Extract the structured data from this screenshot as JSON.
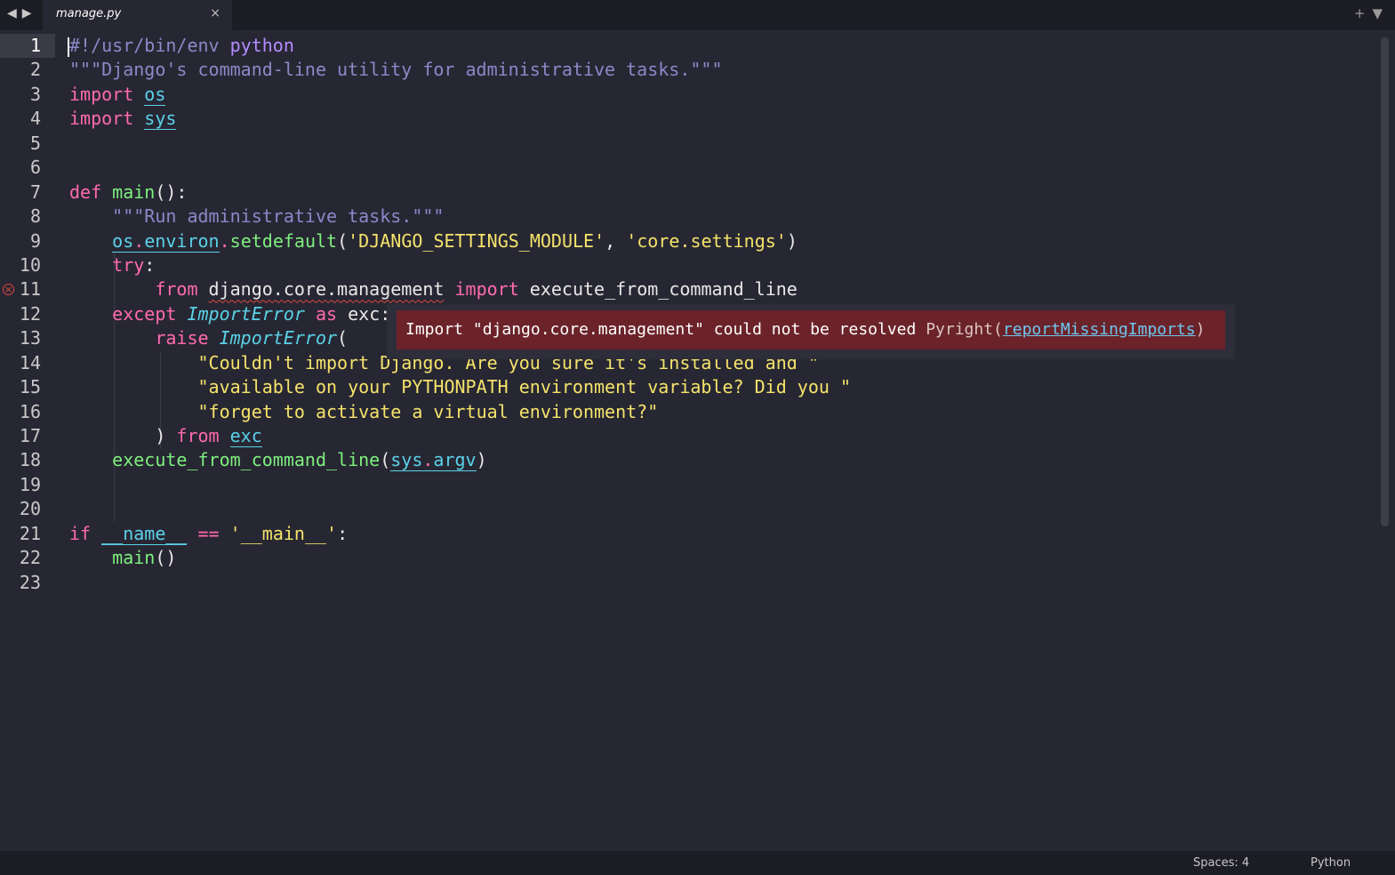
{
  "tabbar": {
    "back_label": "◀",
    "forward_label": "▶",
    "tab_title": "manage.py",
    "close_label": "×",
    "new_tab_label": "+",
    "menu_label": "▼"
  },
  "editor": {
    "line_numbers": [
      "1",
      "2",
      "3",
      "4",
      "5",
      "6",
      "7",
      "8",
      "9",
      "10",
      "11",
      "12",
      "13",
      "14",
      "15",
      "16",
      "17",
      "18",
      "19",
      "20",
      "21",
      "22",
      "23"
    ],
    "error_icon": "×",
    "code": {
      "l1_a": "#!/usr/bin/env ",
      "l1_b": "python",
      "l2": "\"\"\"Django's command-line utility for administrative tasks.\"\"\"",
      "l3_kw": "import",
      "l3_mod": "os",
      "l4_kw": "import",
      "l4_mod": "sys",
      "l7_kw": "def",
      "l7_fn": "main",
      "l7_rest": "():",
      "l8": "\"\"\"Run administrative tasks.\"\"\"",
      "l9_mod1": "os",
      "l9_dot1": ".",
      "l9_mod2": "environ",
      "l9_dot2": ".",
      "l9_fn": "setdefault",
      "l9_p1": "(",
      "l9_s1": "'DJANGO_SETTINGS_MODULE'",
      "l9_c": ", ",
      "l9_s2": "'core.settings'",
      "l9_p2": ")",
      "l10_kw": "try",
      "l10_rest": ":",
      "l11_kw1": "from",
      "l11_mod": "django.core.management",
      "l11_kw2": "import",
      "l11_rest": "execute_from_command_line",
      "l12_kw": "except",
      "l12_cls": "ImportError",
      "l12_kw2": "as",
      "l12_rest": "exc:",
      "l13_kw": "raise",
      "l13_cls": "ImportError",
      "l13_rest": "(",
      "l14": "\"Couldn't import Django. Are you sure it's installed and \"",
      "l15": "\"available on your PYTHONPATH environment variable? Did you \"",
      "l16": "\"forget to activate a virtual environment?\"",
      "l17_a": ") ",
      "l17_kw": "from",
      "l17_mod": "exc",
      "l18_fn": "execute_from_command_line",
      "l18_p1": "(",
      "l18_mod1": "sys",
      "l18_dot": ".",
      "l18_mod2": "argv",
      "l18_p2": ")",
      "l21_kw": "if",
      "l21_mod": "__name__",
      "l21_op": "==",
      "l21_str": "'__main__'",
      "l21_rest": ":",
      "l22_fn": "main",
      "l22_rest": "()"
    }
  },
  "tooltip": {
    "message": "Import \"django.core.management\" could not be resolved",
    "source": "Pyright(",
    "rule": "reportMissingImports",
    "close_paren": ")"
  },
  "statusbar": {
    "spaces": "Spaces: 4",
    "language": "Python"
  }
}
